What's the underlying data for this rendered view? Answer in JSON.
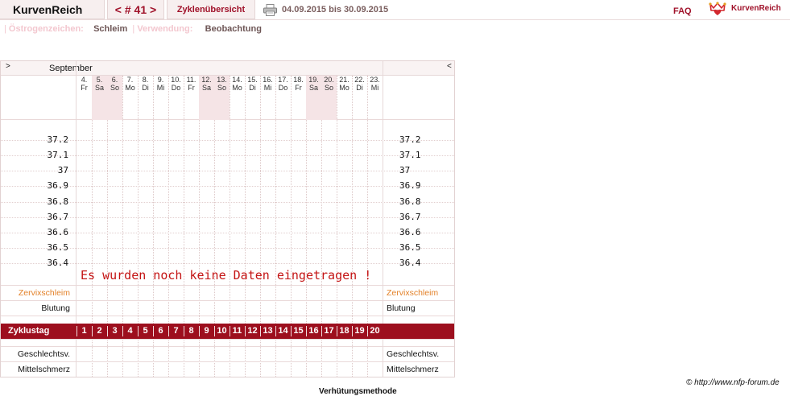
{
  "header": {
    "app_title": "KurvenReich",
    "cycle_nav": "< # 41 >",
    "overview_tab": "Zyklenübersicht",
    "date_range": "04.09.2015 bis 30.09.2015",
    "faq": "FAQ",
    "brand": "KurvenReich",
    "print_icon": "printer-icon",
    "brand_icon": "crown-heart-icon"
  },
  "subbar": {
    "estrogen_label": "Östrogenzeichen:",
    "estrogen_value": "Schleim",
    "usage_label": "Verwendung:",
    "usage_value": "Beobachtung"
  },
  "chart": {
    "month": "September",
    "nav_prev": ">",
    "nav_next": "<",
    "days": [
      {
        "num": "4.",
        "wd": "Fr",
        "weekend": false
      },
      {
        "num": "5.",
        "wd": "Sa",
        "weekend": true
      },
      {
        "num": "6.",
        "wd": "So",
        "weekend": true
      },
      {
        "num": "7.",
        "wd": "Mo",
        "weekend": false
      },
      {
        "num": "8.",
        "wd": "Di",
        "weekend": false
      },
      {
        "num": "9.",
        "wd": "Mi",
        "weekend": false
      },
      {
        "num": "10.",
        "wd": "Do",
        "weekend": false
      },
      {
        "num": "11.",
        "wd": "Fr",
        "weekend": false
      },
      {
        "num": "12.",
        "wd": "Sa",
        "weekend": true
      },
      {
        "num": "13.",
        "wd": "So",
        "weekend": true
      },
      {
        "num": "14.",
        "wd": "Mo",
        "weekend": false
      },
      {
        "num": "15.",
        "wd": "Di",
        "weekend": false
      },
      {
        "num": "16.",
        "wd": "Mi",
        "weekend": false
      },
      {
        "num": "17.",
        "wd": "Do",
        "weekend": false
      },
      {
        "num": "18.",
        "wd": "Fr",
        "weekend": false
      },
      {
        "num": "19.",
        "wd": "Sa",
        "weekend": true
      },
      {
        "num": "20.",
        "wd": "So",
        "weekend": true
      },
      {
        "num": "21.",
        "wd": "Mo",
        "weekend": false
      },
      {
        "num": "22.",
        "wd": "Di",
        "weekend": false
      },
      {
        "num": "23.",
        "wd": "Mi",
        "weekend": false
      }
    ],
    "temperatures": [
      "37.2",
      "37.1",
      "37",
      "36.9",
      "36.8",
      "36.7",
      "36.6",
      "36.5",
      "36.4"
    ],
    "no_data_message": "Es wurden noch keine Daten eingetragen !",
    "row_labels": {
      "cervix": "Zervixschleim",
      "bleeding": "Blutung",
      "cycle_day": "Zyklustag",
      "intercourse": "Geschlechtsv.",
      "mittelschmerz": "Mittelschmerz"
    },
    "cycle_days": [
      "1",
      "2",
      "3",
      "4",
      "5",
      "6",
      "7",
      "8",
      "9",
      "10",
      "11",
      "12",
      "13",
      "14",
      "15",
      "16",
      "17",
      "18",
      "19",
      "20"
    ]
  },
  "footer": {
    "copyright": "© http://www.nfp-forum.de",
    "method_partial": "Verhütungsmethode"
  },
  "colors": {
    "accent": "#a0122a",
    "cycle_bar": "#9d0f1e",
    "orange": "#e3822a",
    "no_data": "#c41414",
    "weekend": "#f5e4e6"
  }
}
